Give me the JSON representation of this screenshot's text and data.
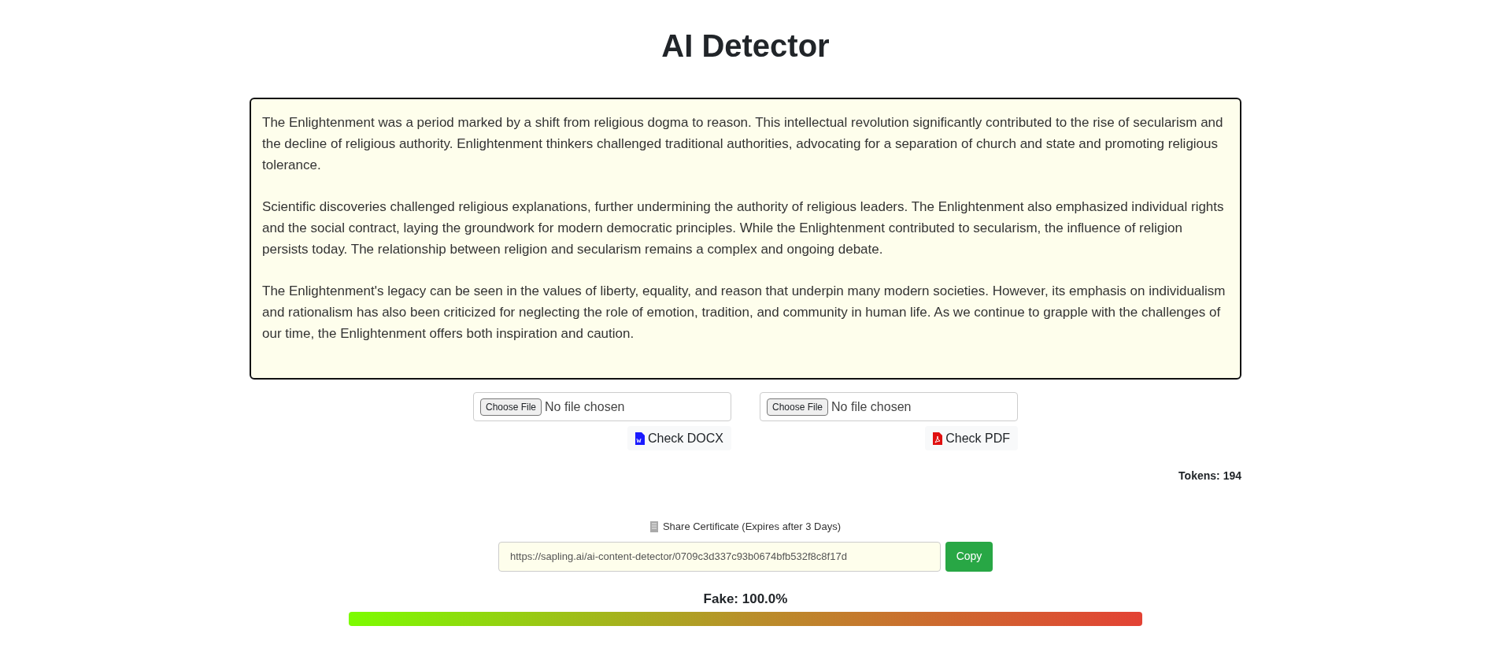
{
  "title": "AI Detector",
  "text_input": {
    "paragraphs": [
      "The Enlightenment was a period marked by a shift from religious dogma to reason. This intellectual revolution significantly contributed to the rise of secularism and the decline of religious authority. Enlightenment thinkers challenged traditional authorities, advocating for a separation of church and state and promoting religious tolerance.",
      "Scientific discoveries challenged religious explanations, further undermining the authority of religious leaders. The Enlightenment also emphasized individual rights and the social contract, laying the groundwork for modern democratic principles. While the Enlightenment contributed to secularism, the influence of religion persists today. The relationship between religion and secularism remains a complex and ongoing debate.",
      "The Enlightenment's legacy can be seen in the values of liberty, equality, and reason that underpin many modern societies. However, its emphasis on individualism and rationalism has also been criticized for neglecting the role of emotion, tradition, and community in human life. As we continue to grapple with the challenges of our time, the Enlightenment offers both inspiration and caution."
    ]
  },
  "uploads": [
    {
      "kind": "docx",
      "choose_label": "Choose File",
      "status": "No file chosen",
      "button": "Check DOCX"
    },
    {
      "kind": "pdf",
      "choose_label": "Choose File",
      "status": "No file chosen",
      "button": "Check PDF"
    }
  ],
  "tokens": "Tokens: 194",
  "share": {
    "label": "Share Certificate (Expires after 3 Days)",
    "url": "https://sapling.ai/ai-content-detector/0709c3d337c93b0674bfb532f8c8f17d",
    "copy": "Copy"
  },
  "score": {
    "label": "Fake: 100.0%"
  }
}
